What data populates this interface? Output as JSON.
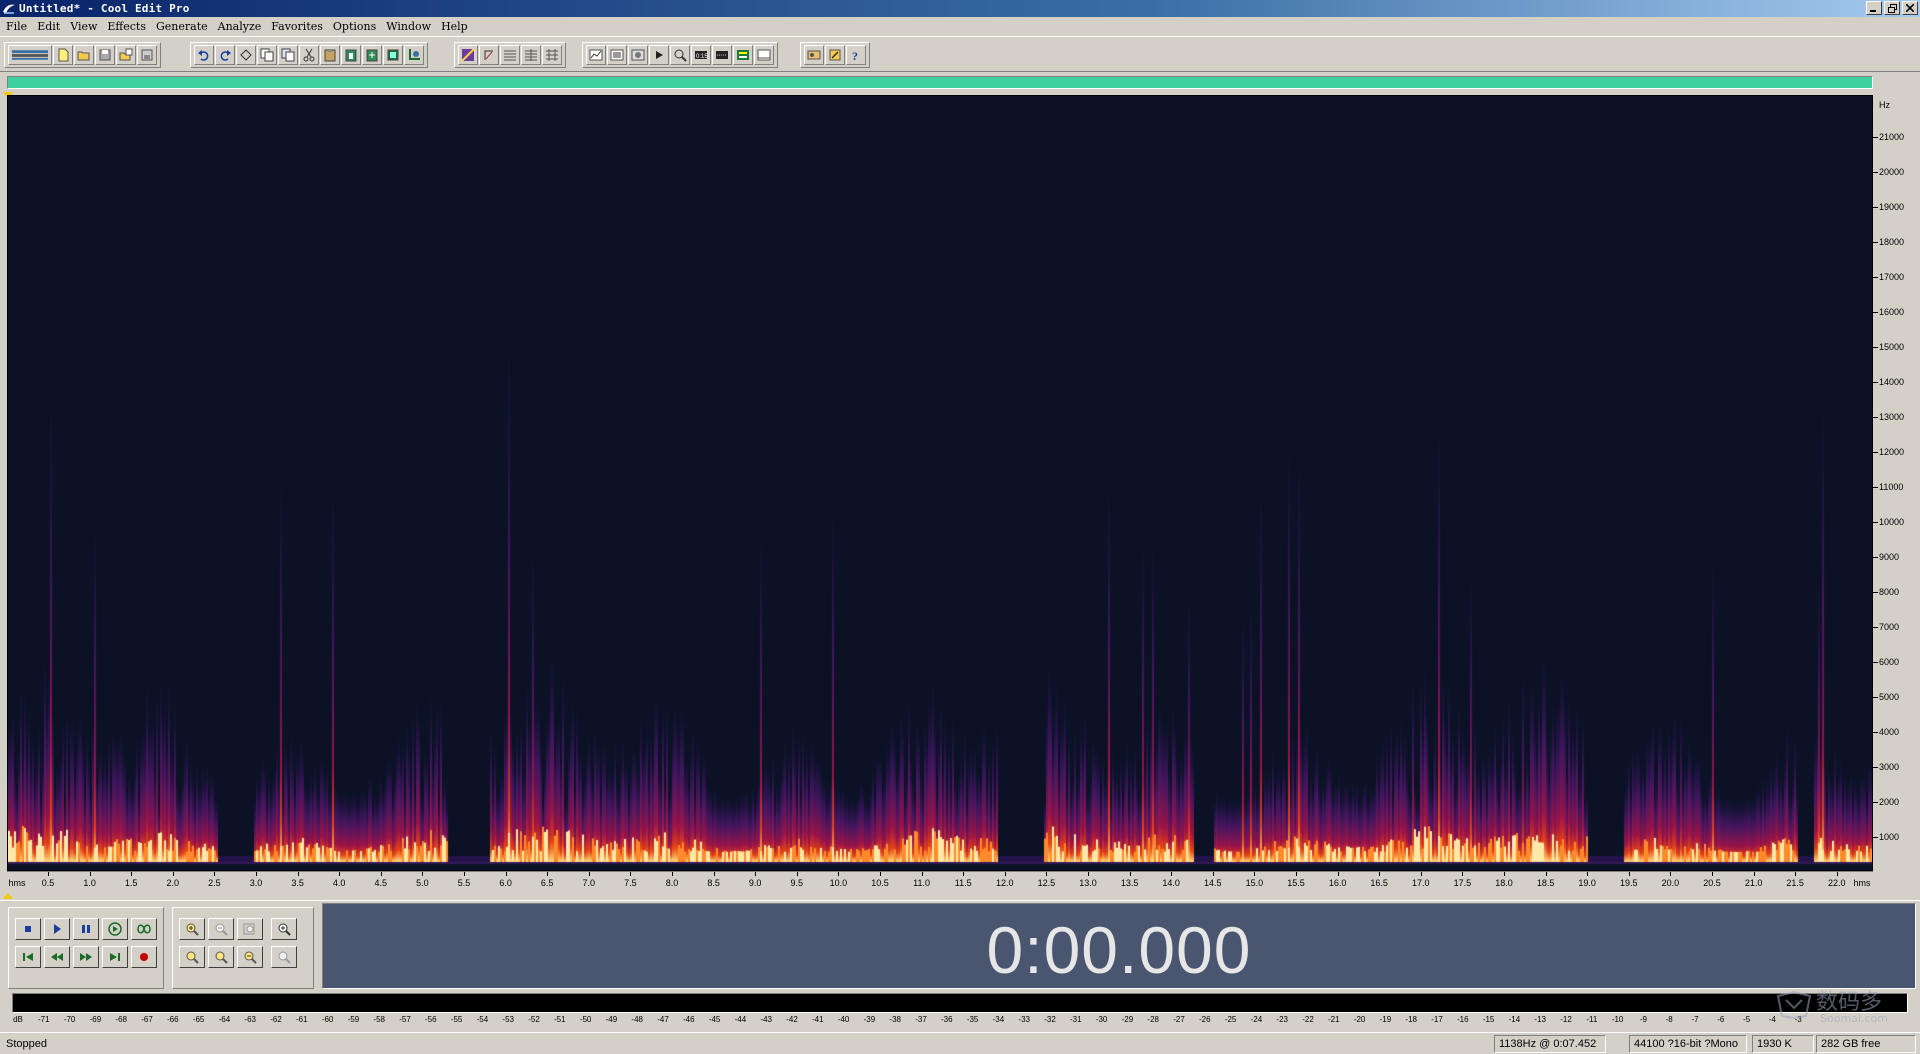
{
  "window": {
    "title": "Untitled* - Cool Edit Pro",
    "controls": [
      "minimize",
      "restore",
      "close"
    ]
  },
  "menu": [
    "File",
    "Edit",
    "View",
    "Effects",
    "Generate",
    "Analyze",
    "Favorites",
    "Options",
    "Window",
    "Help"
  ],
  "toolbar": {
    "icons": [
      "multitrack-toggle-icon",
      "new-file-icon",
      "open-file-icon",
      "save-icon",
      "open-append-icon",
      "save-selection-icon",
      "undo-icon",
      "redo-icon",
      "repeat-last-icon",
      "copy-icon",
      "copy-new-icon",
      "cut-icon",
      "paste-icon",
      "paste-new-icon",
      "mix-paste-icon",
      "trim-icon",
      "crop-icon",
      "waveform-view-icon",
      "spectral-view-icon",
      "time-format-icon",
      "snap-icon",
      "markers-icon",
      "frequency-analysis-icon",
      "statistics-icon",
      "transport-panel-icon",
      "zoom-panel-icon",
      "time-panel-icon",
      "selection-panel-icon",
      "level-meter-icon",
      "status-bar-icon",
      "cd-player-icon",
      "settings-icon",
      "help-icon"
    ]
  },
  "frequency_axis": {
    "unit": "Hz",
    "ticks": [
      "21000",
      "20000",
      "19000",
      "18000",
      "17000",
      "16000",
      "15000",
      "14000",
      "13000",
      "12000",
      "11000",
      "10000",
      "9000",
      "8000",
      "7000",
      "6000",
      "5000",
      "4000",
      "3000",
      "2000",
      "1000"
    ]
  },
  "time_axis": {
    "unit_left": "hms",
    "unit_right": "hms",
    "ticks": [
      "0.5",
      "1.0",
      "1.5",
      "2.0",
      "2.5",
      "3.0",
      "3.5",
      "4.0",
      "4.5",
      "5.0",
      "5.5",
      "6.0",
      "6.5",
      "7.0",
      "7.5",
      "8.0",
      "8.5",
      "9.0",
      "9.5",
      "10.0",
      "10.5",
      "11.0",
      "11.5",
      "12.0",
      "12.5",
      "13.0",
      "13.5",
      "14.0",
      "14.5",
      "15.0",
      "15.5",
      "16.0",
      "16.5",
      "17.0",
      "17.5",
      "18.0",
      "18.5",
      "19.0",
      "19.5",
      "20.0",
      "20.5",
      "21.0",
      "21.5",
      "22.0"
    ]
  },
  "transport": {
    "row1": [
      "stop-icon",
      "play-icon",
      "pause-icon",
      "play-to-end-icon",
      "loop-icon"
    ],
    "row2": [
      "go-to-start-icon",
      "rewind-icon",
      "fast-forward-icon",
      "go-to-end-icon",
      "record-icon"
    ]
  },
  "zoom": {
    "row1": [
      "zoom-in-icon",
      "zoom-out-icon",
      "zoom-full-icon",
      "zoom-vertical-in-icon"
    ],
    "row2": [
      "zoom-left-icon",
      "zoom-right-icon",
      "zoom-selection-icon",
      "zoom-vertical-out-icon"
    ]
  },
  "time_display": "0:00.000",
  "level_meter": {
    "labels": [
      "dB",
      "-71",
      "-70",
      "-69",
      "-68",
      "-67",
      "-66",
      "-65",
      "-64",
      "-63",
      "-62",
      "-61",
      "-60",
      "-59",
      "-58",
      "-57",
      "-56",
      "-55",
      "-54",
      "-53",
      "-52",
      "-51",
      "-50",
      "-49",
      "-48",
      "-47",
      "-46",
      "-45",
      "-44",
      "-43",
      "-42",
      "-41",
      "-40",
      "-39",
      "-38",
      "-37",
      "-36",
      "-35",
      "-34",
      "-33",
      "-32",
      "-31",
      "-30",
      "-29",
      "-28",
      "-27",
      "-26",
      "-25",
      "-24",
      "-23",
      "-22",
      "-21",
      "-20",
      "-19",
      "-18",
      "-17",
      "-16",
      "-15",
      "-14",
      "-13",
      "-12",
      "-11",
      "-10",
      "-9",
      "-8",
      "-7",
      "-6",
      "-5",
      "-4",
      "-3"
    ]
  },
  "status": {
    "state": "Stopped",
    "cursor": "1138Hz @  0:07.452",
    "format": "44100 ?16-bit ?Mono",
    "size": "1930 K",
    "free": "282 GB free"
  },
  "watermark": {
    "text": "数码多",
    "url": "Soomal.com"
  },
  "colors": {
    "overview_bar": "#3ed1a0",
    "spectral_background": "#0b1226",
    "time_display_bg": "#4a5570",
    "time_display_fg": "#e6e6e6",
    "start_marker": "#f5c800"
  }
}
